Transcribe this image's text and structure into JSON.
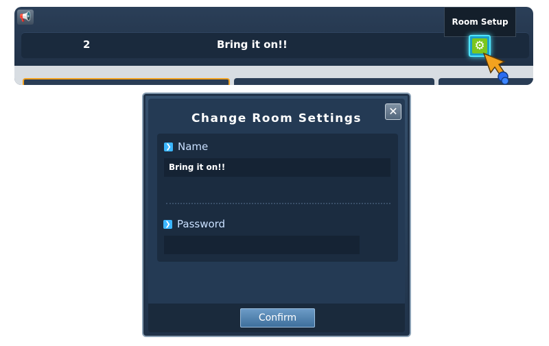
{
  "room_bar": {
    "speaker_icon": "megaphone-icon",
    "room_number": "2",
    "room_title": "Bring it on!!",
    "settings_icon": "gear-icon",
    "tooltip": "Room Setup",
    "accent_color": "#4fe6ff"
  },
  "dialog": {
    "title": "Change Room Settings",
    "close_icon": "close-icon",
    "name_label": "Name",
    "name_value": "Bring it on!!",
    "password_label": "Password",
    "password_value": "",
    "confirm_label": "Confirm"
  }
}
